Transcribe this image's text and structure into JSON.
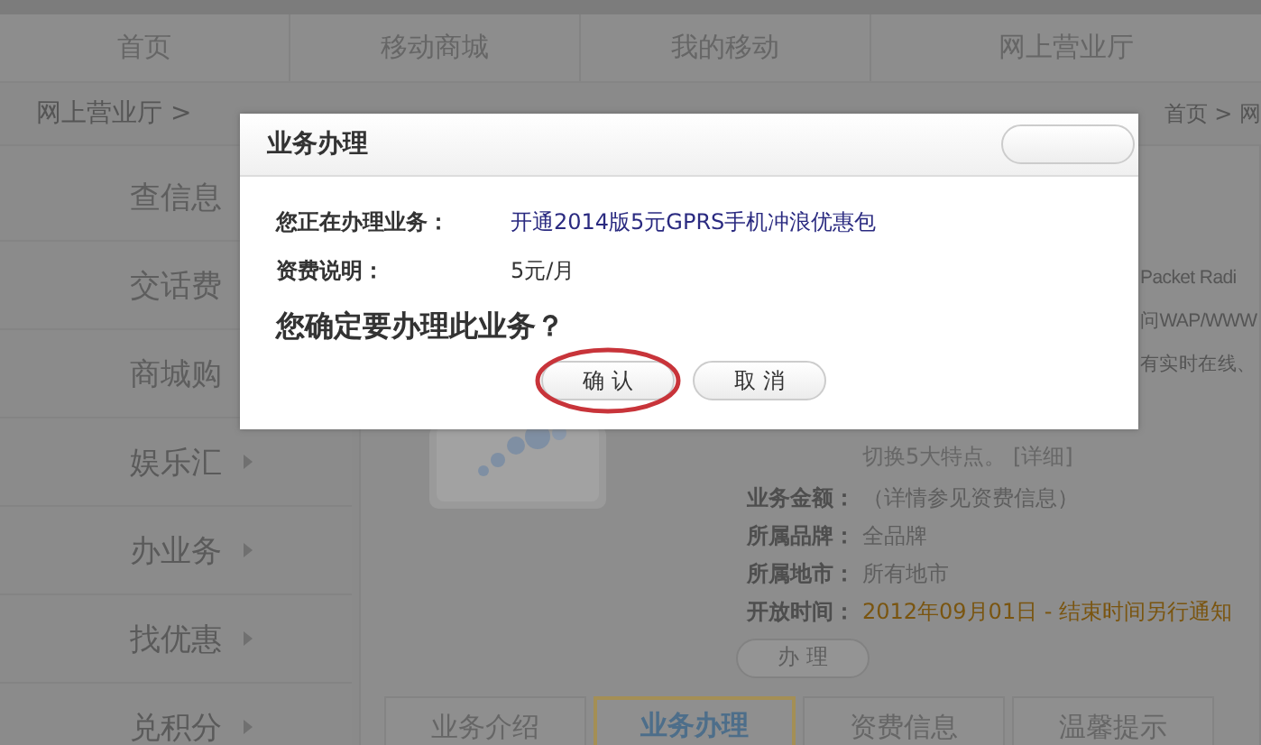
{
  "nav": [
    {
      "label": "首页"
    },
    {
      "label": "移动商城"
    },
    {
      "label": "我的移动"
    },
    {
      "label": "网上营业厅"
    }
  ],
  "breadcrumb": {
    "left": "网上营业厅 >",
    "right": "首页 > 网"
  },
  "sidebar": {
    "items": [
      {
        "label": "查信息"
      },
      {
        "label": "交话费"
      },
      {
        "label": "商城购"
      },
      {
        "label": "娱乐汇",
        "submenu": true
      },
      {
        "label": "办业务",
        "submenu": true
      },
      {
        "label": "找优惠",
        "submenu": true
      },
      {
        "label": "兑积分",
        "submenu": true
      }
    ]
  },
  "description_fragments": [
    "Packet Radi",
    "问WAP/WWW",
    "有实时在线、"
  ],
  "description_tail": "切换5大特点。 [详细]",
  "info": [
    {
      "label": "业务金额：",
      "value": "（详情参见资费信息）",
      "kind": "plain"
    },
    {
      "label": "所属品牌：",
      "value": "全品牌",
      "kind": "plain"
    },
    {
      "label": "所属地市：",
      "value": "所有地市",
      "kind": "plain"
    },
    {
      "label": "开放时间：",
      "value": "2012年09月01日 - 结束时间另行通知",
      "kind": "highlight"
    }
  ],
  "apply_button": "办 理",
  "tabs": [
    {
      "label": "业务介绍",
      "selected": false
    },
    {
      "label": "业务办理",
      "selected": true
    },
    {
      "label": "资费信息",
      "selected": false
    },
    {
      "label": "温馨提示",
      "selected": false
    }
  ],
  "dialog": {
    "title": "业务办理",
    "fields": [
      {
        "label": "您正在办理业务：",
        "value": "开通2014版5元GPRS手机冲浪优惠包",
        "kind": "link"
      },
      {
        "label": "资费说明：",
        "value": "5元/月",
        "kind": "plain"
      }
    ],
    "question": "您确定要办理此业务？",
    "confirm": "确 认",
    "cancel": "取 消",
    "confirm_circled": true
  }
}
